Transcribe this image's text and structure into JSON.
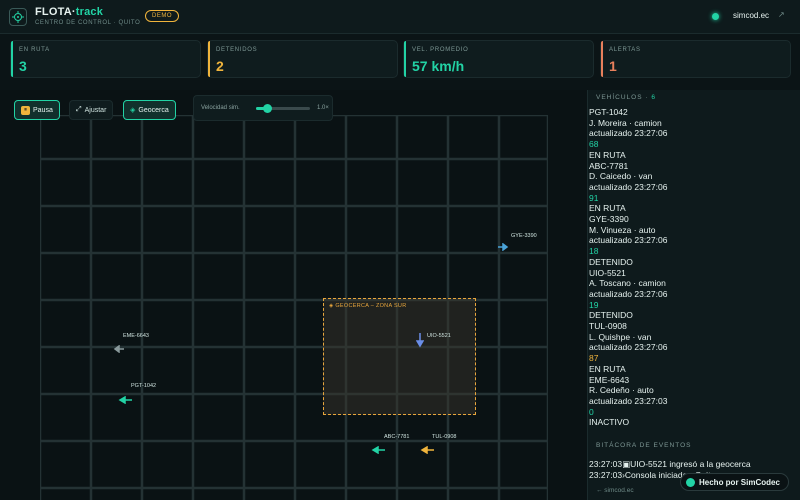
{
  "header": {
    "brand_main": "FLOTA·",
    "brand_accent": "track",
    "subtitle": "CENTRO DE CONTROL · QUITO",
    "badge": "DEMO",
    "site_link": "simcod.ec",
    "ext_icon": "↗"
  },
  "kpis": [
    {
      "label": "EN RUTA",
      "value": "3",
      "color": "#22d3a5"
    },
    {
      "label": "DETENIDOS",
      "value": "2",
      "color": "#f0b43c"
    },
    {
      "label": "VEL. PROMEDIO",
      "value": "57 km/h",
      "color": "#22d3a5"
    },
    {
      "label": "ALERTAS",
      "value": "1",
      "color": "#e8805c"
    }
  ],
  "controls": {
    "pause": "Pausa",
    "pause_icon": "⏸",
    "fit": "Ajustar",
    "fit_icon": "⤢",
    "geofence": "Geocerca",
    "geofence_icon": "◈",
    "speed_label": "Velocidad sim.",
    "speed_value": "1.0×",
    "speed_fraction": 0.2
  },
  "geofence": {
    "label": "◈ GEOCERCA – ZONA SUR"
  },
  "vehicles_map": [
    {
      "id": "GYE-3390",
      "color": "#4aa3d8",
      "dir": "right"
    },
    {
      "id": "EME-6643",
      "color": "#8a9a9c",
      "dir": "left"
    },
    {
      "id": "UIO-5521",
      "color": "#6a8ee8",
      "dir": "down"
    },
    {
      "id": "PGT-1042",
      "color": "#22d3a5",
      "dir": "left"
    },
    {
      "id": "ABC-7781",
      "color": "#22d3a5",
      "dir": "left"
    },
    {
      "id": "TUL-0908",
      "color": "#f0b43c",
      "dir": "left"
    }
  ],
  "sidebar": {
    "title": "VEHÍCULOS · ",
    "count": "6",
    "vehicles": [
      {
        "plate": "PGT-1042",
        "driver": "J. Moreira · camion",
        "updated": "actualizado 23:27:06",
        "speed": "68",
        "speed_color": "#22d3a5",
        "status": "EN RUTA"
      },
      {
        "plate": "ABC-7781",
        "driver": "D. Caicedo · van",
        "updated": "actualizado 23:27:06",
        "speed": "91",
        "speed_color": "#22d3a5",
        "status": "EN RUTA"
      },
      {
        "plate": "GYE-3390",
        "driver": "M. Vinueza · auto",
        "updated": "actualizado 23:27:06",
        "speed": "18",
        "speed_color": "#22d3a5",
        "status": "DETENIDO"
      },
      {
        "plate": "UIO-5521",
        "driver": "A. Toscano · camion",
        "updated": "actualizado 23:27:06",
        "speed": "19",
        "speed_color": "#22d3a5",
        "status": "DETENIDO"
      },
      {
        "plate": "TUL-0908",
        "driver": "L. Quishpe · van",
        "updated": "actualizado 23:27:06",
        "speed": "87",
        "speed_color": "#f0b43c",
        "status": "EN RUTA"
      },
      {
        "plate": "EME-6643",
        "driver": "R. Cedeño · auto",
        "updated": "actualizado 23:27:03",
        "speed": "0",
        "speed_color": "#22d3a5",
        "status": "INACTIVO"
      }
    ],
    "log_title": "BITÁCORA DE EVENTOS",
    "log": [
      "23:27:03▣UIO-5521 ingresó a la geocerca",
      "23:27:03›Consola iniciada · Quito"
    ],
    "footer_link": "← simcod.ec"
  },
  "made_by": "Hecho por SimCodec"
}
